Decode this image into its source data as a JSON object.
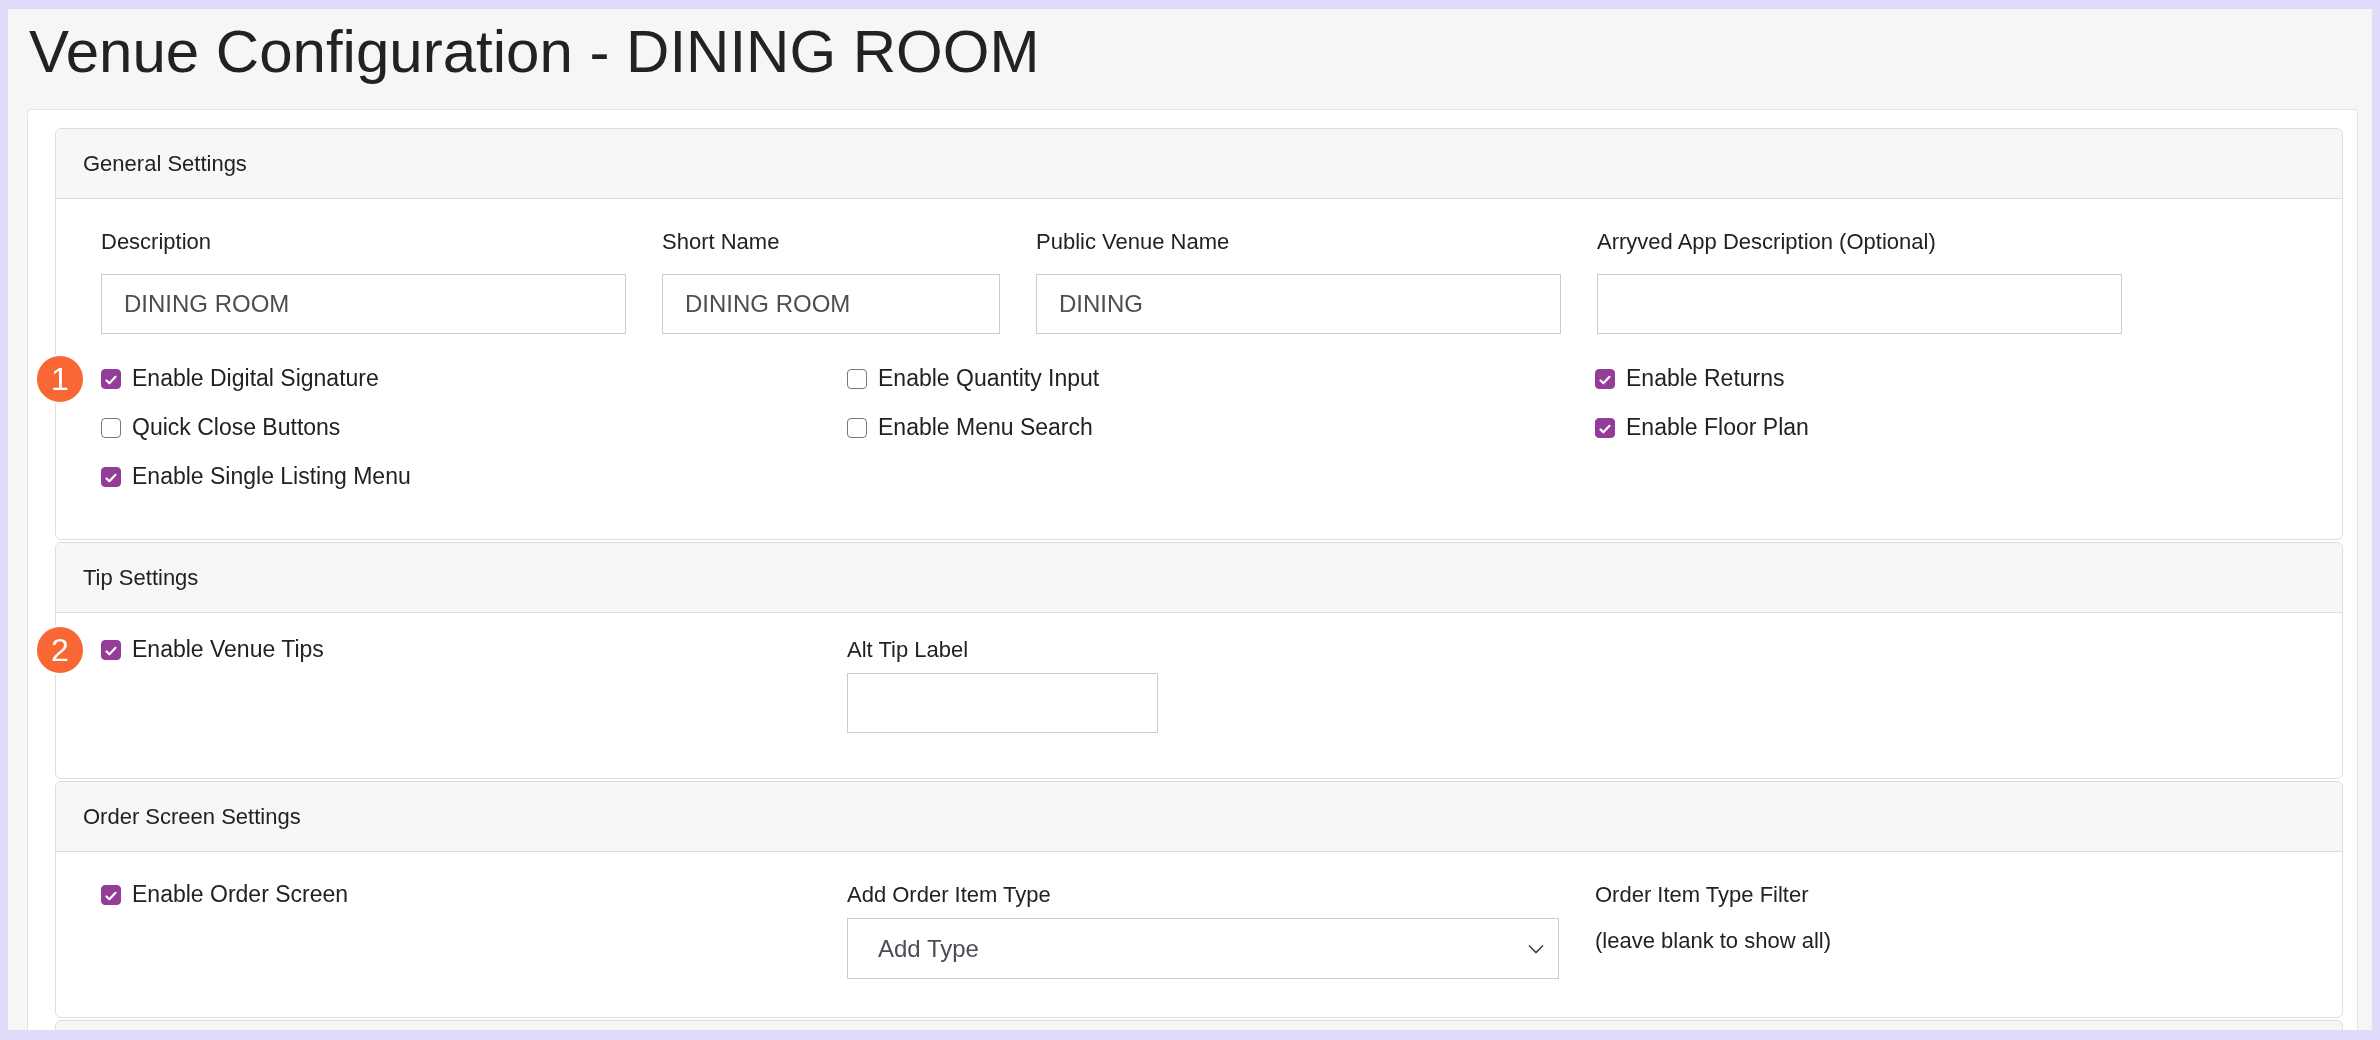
{
  "page": {
    "title": "Venue Configuration - DINING ROOM"
  },
  "general": {
    "title": "General Settings",
    "fields": [
      {
        "label": "Description",
        "value": "DINING ROOM"
      },
      {
        "label": "Short Name",
        "value": "DINING ROOM"
      },
      {
        "label": "Public Venue Name",
        "value": "DINING"
      },
      {
        "label": "Arryved App Description (Optional)"
      }
    ],
    "checkbox_columns": [
      [
        {
          "label": "Enable Digital Signature",
          "checked": true,
          "badge": "1"
        },
        {
          "label": "Quick Close Buttons",
          "checked": false
        },
        {
          "label": "Enable Single Listing Menu",
          "checked": true
        }
      ],
      [
        {
          "label": "Enable Quantity Input",
          "checked": false
        },
        {
          "label": "Enable Menu Search",
          "checked": false
        }
      ],
      [
        {
          "label": "Enable Returns",
          "checked": true
        },
        {
          "label": "Enable Floor Plan",
          "checked": true
        }
      ]
    ]
  },
  "tips": {
    "title": "Tip Settings",
    "checkbox": {
      "label": "Enable Venue Tips",
      "checked": true,
      "badge": "2"
    },
    "field": {
      "label": "Alt Tip Label"
    }
  },
  "order": {
    "title": "Order Screen Settings",
    "checkbox": {
      "label": "Enable Order Screen",
      "checked": true
    },
    "select": {
      "label": "Add Order Item Type",
      "value": "Add Type"
    },
    "filter_label": [
      "Order Item Type Filter",
      "(leave blank to show all)"
    ]
  }
}
